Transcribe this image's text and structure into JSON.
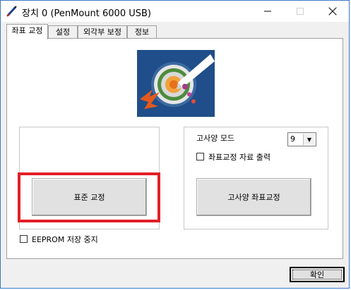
{
  "window": {
    "title": "장치 0 (PenMount 6000 USB)",
    "controls": {
      "minimize": "—",
      "maximize": "☐",
      "close": "✕"
    }
  },
  "tabs": [
    {
      "label": "좌표 교정",
      "active": true
    },
    {
      "label": "설정",
      "active": false
    },
    {
      "label": "외각부 보정",
      "active": false
    },
    {
      "label": "정보",
      "active": false
    }
  ],
  "calibration": {
    "standard_button": "표준 교정",
    "eeprom_checkbox": {
      "label": "EEPROM 저장 중지",
      "checked": false
    }
  },
  "advanced": {
    "mode_label": "고사양 모드",
    "mode_value": "9",
    "output_checkbox": {
      "label": "좌표교정 자료 출력",
      "checked": false
    },
    "advanced_button": "고사양 좌표교정"
  },
  "footer": {
    "ok_button": "확인"
  },
  "colors": {
    "highlight": "#e21f26",
    "logo_bg": "#1f4e8a",
    "window_border": "#3c77c8"
  }
}
